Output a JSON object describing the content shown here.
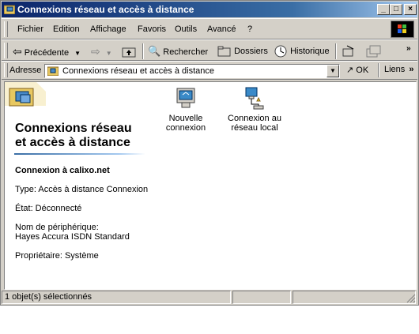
{
  "window": {
    "title": "Connexions réseau et accès à distance"
  },
  "menu": {
    "items": [
      {
        "label": "Fichier"
      },
      {
        "label": "Edition"
      },
      {
        "label": "Affichage"
      },
      {
        "label": "Favoris"
      },
      {
        "label": "Outils"
      },
      {
        "label": "Avancé"
      },
      {
        "label": "?"
      }
    ]
  },
  "toolbar": {
    "back_label": "Précédente",
    "search_label": "Rechercher",
    "folders_label": "Dossiers",
    "history_label": "Historique"
  },
  "address": {
    "label": "Adresse",
    "value": "Connexions réseau et accès à distance",
    "go_label": "OK",
    "links_label": "Liens"
  },
  "panel": {
    "title_line1": "Connexions réseau",
    "title_line2": "et accès à distance",
    "selected_name": "Connexion à calixo.net",
    "type": "Type: Accès à distance Connexion",
    "state": "État: Déconnecté",
    "device_label": "Nom de périphérique:",
    "device_value": "Hayes Accura ISDN Standard",
    "owner": "Propriétaire: Système"
  },
  "items": [
    {
      "line1": "Nouvelle",
      "line2": "connexion"
    },
    {
      "line1": "Connexion au",
      "line2": "réseau local"
    }
  ],
  "status": {
    "text": "1 objet(s) sélectionnés"
  },
  "colors": {
    "title_bar": "#0a246a",
    "chrome": "#d4d0c8",
    "accent": "#3a6ea5"
  }
}
